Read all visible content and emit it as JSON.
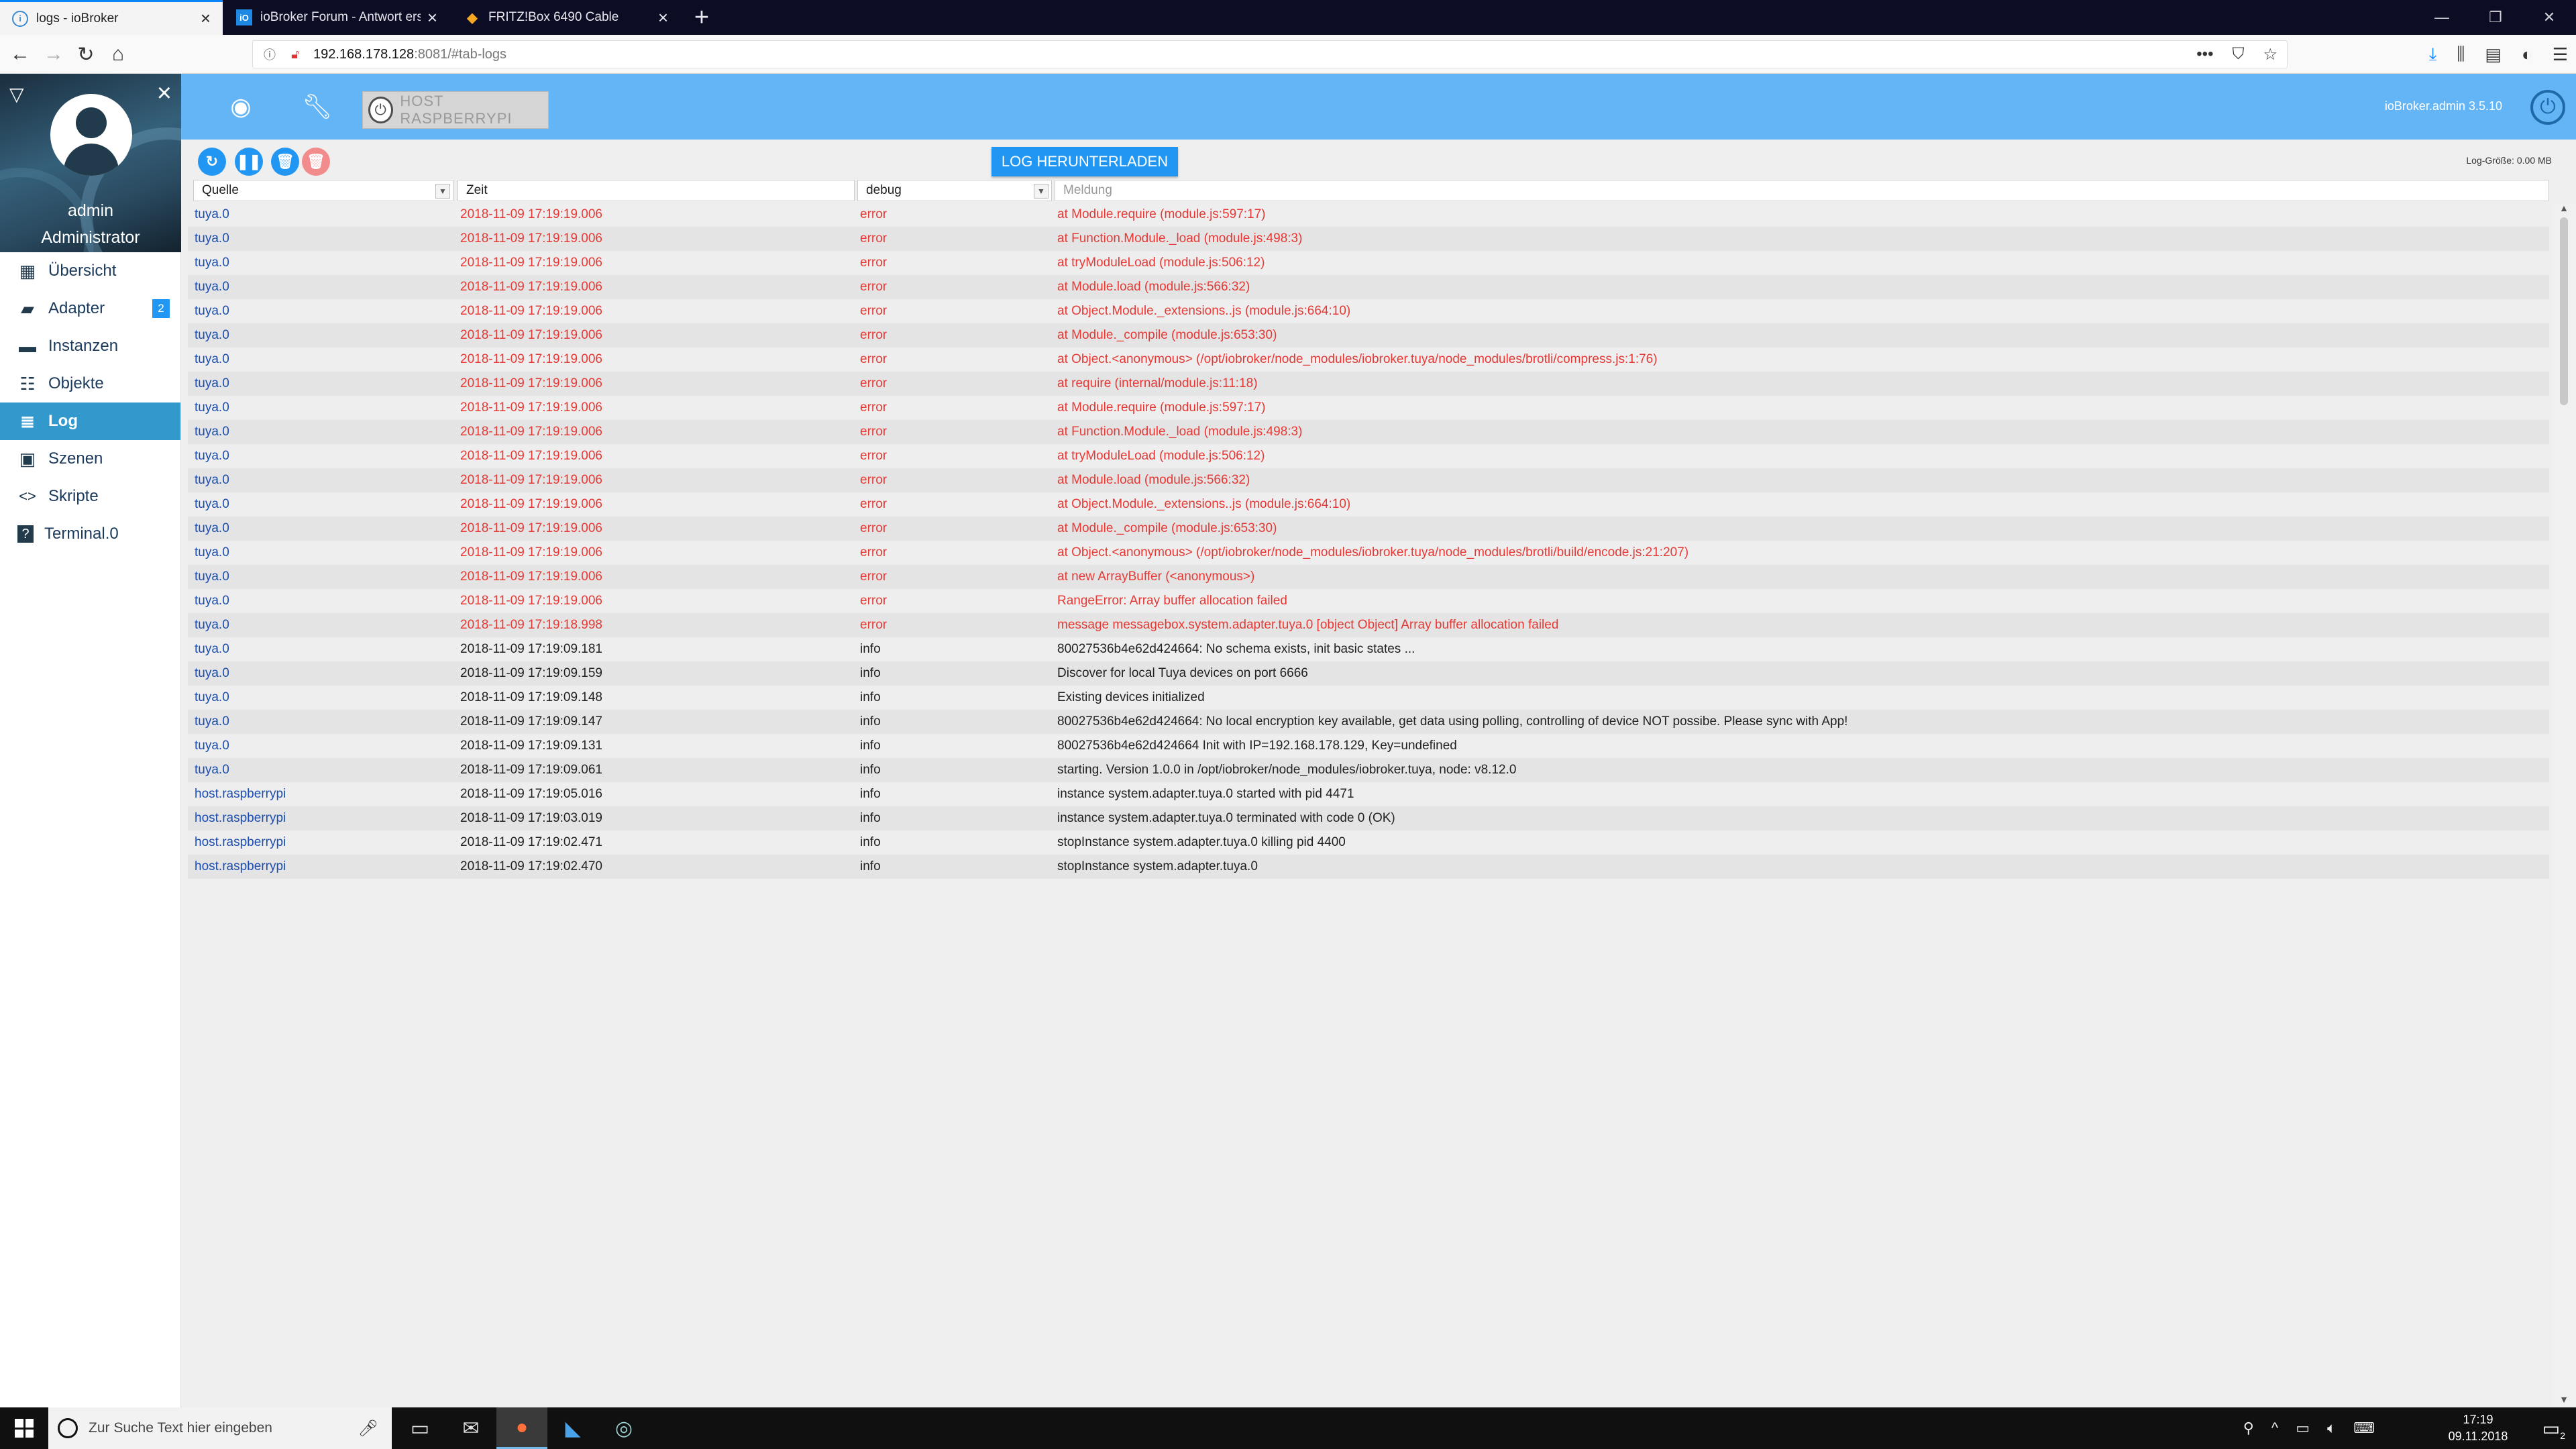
{
  "browser": {
    "tabs": [
      {
        "title": "logs - ioBroker",
        "favicon": "iobroker-icon",
        "active": true
      },
      {
        "title": "ioBroker Forum - Antwort erste",
        "favicon": "forum-icon",
        "active": false
      },
      {
        "title": "FRITZ!Box 6490 Cable",
        "favicon": "fritzbox-icon",
        "active": false
      }
    ],
    "new_tab": "+",
    "url_host": "192.168.178.128",
    "url_rest": ":8081/#tab-logs"
  },
  "sidebar": {
    "user_name": "admin",
    "user_role": "Administrator",
    "items": [
      {
        "label": "Übersicht",
        "icon": "grid-icon"
      },
      {
        "label": "Adapter",
        "icon": "adapter-icon",
        "badge": "2"
      },
      {
        "label": "Instanzen",
        "icon": "instances-icon"
      },
      {
        "label": "Objekte",
        "icon": "list-icon"
      },
      {
        "label": "Log",
        "icon": "log-icon",
        "active": true
      },
      {
        "label": "Szenen",
        "icon": "scenes-icon"
      },
      {
        "label": "Skripte",
        "icon": "code-icon"
      },
      {
        "label": "Terminal.0",
        "icon": "help-icon"
      }
    ]
  },
  "header": {
    "host_button": "HOST RASPBERRYPI",
    "version": "ioBroker.admin 3.5.10"
  },
  "logbar": {
    "download_label": "LOG HERUNTERLADEN",
    "log_size": "Log-Größe: 0.00 MB"
  },
  "filters": {
    "source": "Quelle",
    "time": "Zeit",
    "severity": "debug",
    "message_placeholder": "Meldung"
  },
  "log": {
    "rows": [
      {
        "source": "tuya.0",
        "time": "2018-11-09 17:19:19.006",
        "severity": "error",
        "message": "at Module.require (module.js:597:17)"
      },
      {
        "source": "tuya.0",
        "time": "2018-11-09 17:19:19.006",
        "severity": "error",
        "message": "at Function.Module._load (module.js:498:3)"
      },
      {
        "source": "tuya.0",
        "time": "2018-11-09 17:19:19.006",
        "severity": "error",
        "message": "at tryModuleLoad (module.js:506:12)"
      },
      {
        "source": "tuya.0",
        "time": "2018-11-09 17:19:19.006",
        "severity": "error",
        "message": "at Module.load (module.js:566:32)"
      },
      {
        "source": "tuya.0",
        "time": "2018-11-09 17:19:19.006",
        "severity": "error",
        "message": "at Object.Module._extensions..js (module.js:664:10)"
      },
      {
        "source": "tuya.0",
        "time": "2018-11-09 17:19:19.006",
        "severity": "error",
        "message": "at Module._compile (module.js:653:30)"
      },
      {
        "source": "tuya.0",
        "time": "2018-11-09 17:19:19.006",
        "severity": "error",
        "message": "at Object.<anonymous> (/opt/iobroker/node_modules/iobroker.tuya/node_modules/brotli/compress.js:1:76)"
      },
      {
        "source": "tuya.0",
        "time": "2018-11-09 17:19:19.006",
        "severity": "error",
        "message": "at require (internal/module.js:11:18)"
      },
      {
        "source": "tuya.0",
        "time": "2018-11-09 17:19:19.006",
        "severity": "error",
        "message": "at Module.require (module.js:597:17)"
      },
      {
        "source": "tuya.0",
        "time": "2018-11-09 17:19:19.006",
        "severity": "error",
        "message": "at Function.Module._load (module.js:498:3)"
      },
      {
        "source": "tuya.0",
        "time": "2018-11-09 17:19:19.006",
        "severity": "error",
        "message": "at tryModuleLoad (module.js:506:12)"
      },
      {
        "source": "tuya.0",
        "time": "2018-11-09 17:19:19.006",
        "severity": "error",
        "message": "at Module.load (module.js:566:32)"
      },
      {
        "source": "tuya.0",
        "time": "2018-11-09 17:19:19.006",
        "severity": "error",
        "message": "at Object.Module._extensions..js (module.js:664:10)"
      },
      {
        "source": "tuya.0",
        "time": "2018-11-09 17:19:19.006",
        "severity": "error",
        "message": "at Module._compile (module.js:653:30)"
      },
      {
        "source": "tuya.0",
        "time": "2018-11-09 17:19:19.006",
        "severity": "error",
        "message": "at Object.<anonymous> (/opt/iobroker/node_modules/iobroker.tuya/node_modules/brotli/build/encode.js:21:207)"
      },
      {
        "source": "tuya.0",
        "time": "2018-11-09 17:19:19.006",
        "severity": "error",
        "message": "at new ArrayBuffer (<anonymous>)"
      },
      {
        "source": "tuya.0",
        "time": "2018-11-09 17:19:19.006",
        "severity": "error",
        "message": "RangeError: Array buffer allocation failed"
      },
      {
        "source": "tuya.0",
        "time": "2018-11-09 17:19:18.998",
        "severity": "error",
        "message": "message messagebox.system.adapter.tuya.0 [object Object] Array buffer allocation failed"
      },
      {
        "source": "tuya.0",
        "time": "2018-11-09 17:19:09.181",
        "severity": "info",
        "message": "80027536b4e62d424664: No schema exists, init basic states ..."
      },
      {
        "source": "tuya.0",
        "time": "2018-11-09 17:19:09.159",
        "severity": "info",
        "message": "Discover for local Tuya devices on port 6666"
      },
      {
        "source": "tuya.0",
        "time": "2018-11-09 17:19:09.148",
        "severity": "info",
        "message": "Existing devices initialized"
      },
      {
        "source": "tuya.0",
        "time": "2018-11-09 17:19:09.147",
        "severity": "info",
        "message": "80027536b4e62d424664: No local encryption key available, get data using polling, controlling of device NOT possibe. Please sync with App!"
      },
      {
        "source": "tuya.0",
        "time": "2018-11-09 17:19:09.131",
        "severity": "info",
        "message": "80027536b4e62d424664 Init with IP=192.168.178.129, Key=undefined"
      },
      {
        "source": "tuya.0",
        "time": "2018-11-09 17:19:09.061",
        "severity": "info",
        "message": "starting. Version 1.0.0 in /opt/iobroker/node_modules/iobroker.tuya, node: v8.12.0"
      },
      {
        "source": "host.raspberrypi",
        "time": "2018-11-09 17:19:05.016",
        "severity": "info",
        "message": "instance system.adapter.tuya.0 started with pid 4471"
      },
      {
        "source": "host.raspberrypi",
        "time": "2018-11-09 17:19:03.019",
        "severity": "info",
        "message": "instance system.adapter.tuya.0 terminated with code 0 (OK)"
      },
      {
        "source": "host.raspberrypi",
        "time": "2018-11-09 17:19:02.471",
        "severity": "info",
        "message": "stopInstance system.adapter.tuya.0 killing pid 4400"
      },
      {
        "source": "host.raspberrypi",
        "time": "2018-11-09 17:19:02.470",
        "severity": "info",
        "message": "stopInstance system.adapter.tuya.0"
      }
    ]
  },
  "taskbar": {
    "search_placeholder": "Zur Suche Text hier eingeben",
    "time": "17:19",
    "date": "09.11.2018",
    "notification_count": "2"
  },
  "colors": {
    "header_blue": "#64b5f6",
    "accent_blue": "#2196f3",
    "active_menu": "#3399cc",
    "error_red": "#e53935",
    "source_blue": "#1a4db3"
  }
}
